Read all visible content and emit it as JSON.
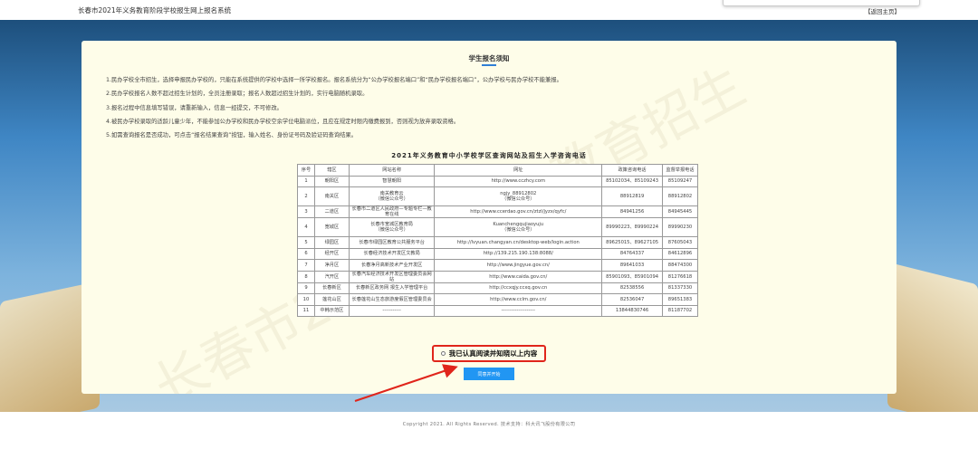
{
  "header": {
    "title": "长春市2021年义务教育阶段学校报生网上报名系统",
    "back_link": "【返回主页】"
  },
  "notice": {
    "title": "学生报名须知",
    "rules": [
      "1.民办学校全市招生，选择申报民办学校的，只能在系统提供的学校中选择一所学校报名。报名系统分为“公办学校报名端口”和“民办学校报名端口”，公办学校与民办学校不能兼报。",
      "2.民办学校报名人数不超过招生计划的，全员注册录取；报名人数超过招生计划的，实行电脑随机录取。",
      "3.报名过程中信息填写错误，请重新输入，信息一经提交，不可修改。",
      "4.被民办学校录取的适龄儿童少年，不能参加公办学校和民办学校空余学位电脑派位，且应在规定时限内缴费报到，否则视为放弃录取资格。",
      "5.如需查询报名是否成功，可点击“报名结果查询”按钮，输入姓名、身份证号码及验证码查询结果。"
    ]
  },
  "table": {
    "title": "2021年义务教育中小学校学区查询网站及招生入学咨询电话",
    "headers": [
      "序号",
      "辖区",
      "网站名称",
      "网址",
      "政策咨询电话",
      "监督举报电话"
    ],
    "rows": [
      {
        "no": "1",
        "district": "朝阳区",
        "site": "智慧朝阳",
        "site_sub": "",
        "url": "http://www.cczhcy.com",
        "url_sub": "",
        "policy": "85102034、85109243",
        "report": "85109247"
      },
      {
        "no": "2",
        "district": "南关区",
        "site": "南关教育云",
        "site_sub": "（微信公众号）",
        "url": "ngjy_88912802",
        "url_sub": "（微信公众号）",
        "policy": "88912819",
        "report": "88912802"
      },
      {
        "no": "3",
        "district": "二道区",
        "site": "长春市二道区人民政府—专题专栏—教育在线",
        "site_sub": "",
        "url": "http://www.ccerdao.gov.cn/ztzl/jyzx/qyfc/",
        "url_sub": "",
        "policy": "84941256",
        "report": "84945445"
      },
      {
        "no": "4",
        "district": "宽城区",
        "site": "长春市宽城区教育局",
        "site_sub": "（微信公众号）",
        "url": "Kuanchengqujiaoyuju",
        "url_sub": "（微信公众号）",
        "policy": "89990223、89990224",
        "report": "89990230"
      },
      {
        "no": "5",
        "district": "绿园区",
        "site": "长春市绿园区教育公共服务平台",
        "site_sub": "",
        "url": "http://lvyuan.changyan.cn/desktop-web/login.action",
        "url_sub": "",
        "policy": "89625015、89627105",
        "report": "87605043"
      },
      {
        "no": "6",
        "district": "经开区",
        "site": "长春经济技术开发区文教局",
        "site_sub": "",
        "url": "http://139.215.190.138:8088/",
        "url_sub": "",
        "policy": "84764337",
        "report": "84612896"
      },
      {
        "no": "7",
        "district": "净月区",
        "site": "长春净月高新技术产业开发区",
        "site_sub": "",
        "url": "http://www.jingyue.gov.cn/",
        "url_sub": "",
        "policy": "89641033",
        "report": "88474300"
      },
      {
        "no": "8",
        "district": "汽开区",
        "site": "长春汽车经济技术开发区管理委员会网站",
        "site_sub": "",
        "url": "http://www.caida.gov.cn/",
        "url_sub": "",
        "policy": "85901093、85901094",
        "report": "81276618"
      },
      {
        "no": "9",
        "district": "长春新区",
        "site": "长春新区政务网 报生入学管理平台",
        "site_sub": "",
        "url": "http://ccxqjy.ccxq.gov.cn",
        "url_sub": "",
        "policy": "82538556",
        "report": "81337330"
      },
      {
        "no": "10",
        "district": "莲花山区",
        "site": "长春莲花山生态旅游度假区管理委员会",
        "site_sub": "",
        "url": "http://www.cclm.gov.cn/",
        "url_sub": "",
        "policy": "82536047",
        "report": "89651383"
      },
      {
        "no": "11",
        "district": "中韩示范区",
        "site": "-----------",
        "site_sub": "",
        "url": "--------------------",
        "url_sub": "",
        "policy": "13844830746",
        "report": "81187702"
      }
    ]
  },
  "agree": {
    "label": "我已认真阅读并知晓以上内容",
    "checked": false
  },
  "start_button": "同意并开始",
  "footer": {
    "copyright": "Copyright 2021. All Rights Reserved. 技术支持：科大讯飞股份有限公司"
  },
  "watermark": "长春市2021年义务教育招生",
  "colors": {
    "accent": "#2196f3",
    "annotation": "#e0251b",
    "card": "#fefde9"
  }
}
